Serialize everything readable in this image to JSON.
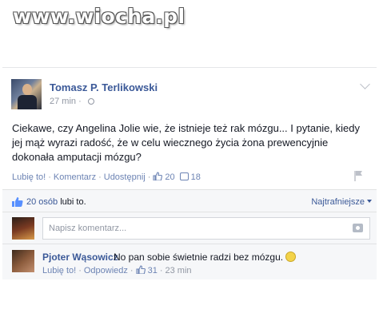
{
  "watermark": "www.wiocha.pl",
  "post": {
    "author": "Tomasz P. Terlikowski",
    "time": "27 min",
    "text": "Ciekawe, czy Angelina Jolie wie, że istnieje też rak mózgu... I pytanie, kiedy jej mąż wyrazi radość, że w celu wiecznego życia żona prewencyjnie dokonała amputacji mózgu?",
    "actions": {
      "like": "Lubię to!",
      "comment": "Komentarz",
      "share": "Udostępnij",
      "sep": "·",
      "like_count": "20",
      "comment_count": "18"
    }
  },
  "likes": {
    "count": "20 osób",
    "suffix": "lubi to.",
    "sort": "Najtrafniejsze"
  },
  "compose": {
    "placeholder": "Napisz komentarz..."
  },
  "comment": {
    "author": "Pjoter Wąsowicz",
    "text": "No pan sobie świetnie radzi bez mózgu.",
    "like": "Lubię to!",
    "reply": "Odpowiedz",
    "likes": "31",
    "time": "23 min",
    "sep": "·"
  },
  "colors": {
    "link": "#3b5998",
    "muted": "#9197a3",
    "panel": "#f6f7f9"
  }
}
